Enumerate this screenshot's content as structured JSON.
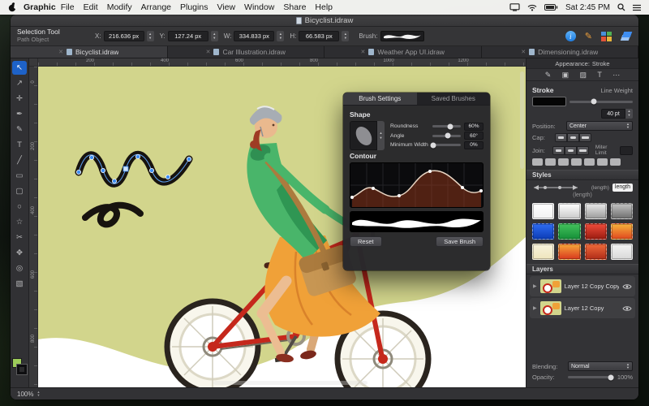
{
  "menubar": {
    "app_name": "Graphic",
    "menus": [
      "File",
      "Edit",
      "Modify",
      "Arrange",
      "Plugins",
      "View",
      "Window",
      "Share",
      "Help"
    ],
    "clock": "Sat 2:45 PM"
  },
  "window": {
    "title": "Bicyclist.idraw"
  },
  "toolbar": {
    "tool_name": "Selection Tool",
    "object_type": "Path Object",
    "fields": [
      {
        "label": "X:",
        "value": "216.636 px"
      },
      {
        "label": "Y:",
        "value": "127.24 px"
      },
      {
        "label": "W:",
        "value": "334.833 px"
      },
      {
        "label": "H:",
        "value": "66.583 px"
      }
    ],
    "brush_label": "Brush:"
  },
  "tabs": [
    {
      "label": "Bicyclist.idraw",
      "active": true
    },
    {
      "label": "Car Illustration.idraw",
      "active": false
    },
    {
      "label": "Weather App UI.idraw",
      "active": false
    },
    {
      "label": "Dimensioning.idraw",
      "active": false
    }
  ],
  "tools": [
    {
      "name": "selection-tool",
      "glyph": "↖",
      "active": true
    },
    {
      "name": "direct-selection-tool",
      "glyph": "↗",
      "active": false
    },
    {
      "name": "move-tool",
      "glyph": "✛",
      "active": false
    },
    {
      "name": "pen-tool",
      "glyph": "✒",
      "active": false
    },
    {
      "name": "pencil-tool",
      "glyph": "✎",
      "active": false
    },
    {
      "name": "text-tool",
      "glyph": "T",
      "active": false
    },
    {
      "name": "line-tool",
      "glyph": "╱",
      "active": false
    },
    {
      "name": "rectangle-tool",
      "glyph": "▭",
      "active": false
    },
    {
      "name": "rounded-rect-tool",
      "glyph": "▢",
      "active": false
    },
    {
      "name": "ellipse-tool",
      "glyph": "○",
      "active": false
    },
    {
      "name": "star-tool",
      "glyph": "☆",
      "active": false
    },
    {
      "name": "scissors-tool",
      "glyph": "✂",
      "active": false
    },
    {
      "name": "hand-tool",
      "glyph": "✥",
      "active": false
    },
    {
      "name": "zoom-tool",
      "glyph": "◎",
      "active": false
    },
    {
      "name": "gradient-tool",
      "glyph": "▧",
      "active": false
    }
  ],
  "rulers": {
    "top": [
      "200",
      "400",
      "600",
      "800",
      "1000",
      "1200"
    ],
    "left": [
      "0",
      "200",
      "400",
      "600",
      "800"
    ]
  },
  "brush_panel": {
    "tabs": [
      {
        "label": "Brush Settings",
        "active": true
      },
      {
        "label": "Saved Brushes",
        "active": false
      }
    ],
    "shape_title": "Shape",
    "sliders": [
      {
        "label": "Roundness",
        "value": "60%",
        "knob": "62%"
      },
      {
        "label": "Angle",
        "value": "60°",
        "knob": "55%"
      },
      {
        "label": "Minimum Width",
        "value": "0%",
        "knob": "4%"
      }
    ],
    "contour_title": "Contour",
    "reset_label": "Reset",
    "save_label": "Save Brush"
  },
  "sidebar": {
    "appearance_label": "Appearance:",
    "appearance_value": "Stroke",
    "appearance_icons": [
      "✎",
      "▣",
      "▨",
      "T",
      "⋯"
    ],
    "stroke": {
      "title": "Stroke",
      "line_weight_label": "Line Weight",
      "weight_knob": "38%",
      "line_weight_value": "40 pt",
      "position_label": "Position:",
      "position_value": "Center",
      "cap_label": "Cap:",
      "join_label": "Join:",
      "miter_limit_label": "Miter Limit"
    },
    "styles": {
      "title": "Styles",
      "length_inline": "(length)",
      "length_chip": "length",
      "length_caption": "(length)",
      "swatches": [
        {
          "bg": "linear-gradient(180deg,#ffffff,#f2f2f2)"
        },
        {
          "bg": "linear-gradient(180deg,#ffffff,#c9c9c9)"
        },
        {
          "bg": "linear-gradient(180deg,#e9e9e9,#9b9b9b)"
        },
        {
          "bg": "linear-gradient(180deg,#c4c4c4,#6e6e6e)"
        },
        {
          "bg": "linear-gradient(180deg,#2f6bf0,#0c3db8)"
        },
        {
          "bg": "linear-gradient(180deg,#43c05c,#159038)"
        },
        {
          "bg": "linear-gradient(180deg,#ef4b3a,#9c1c10)"
        },
        {
          "bg": "linear-gradient(180deg,#f7b23c,#e0491f)"
        },
        {
          "bg": "linear-gradient(180deg,#f8f3dc,#efe5bd)"
        },
        {
          "bg": "linear-gradient(180deg,#f7a63a,#d8391e)"
        },
        {
          "bg": "linear-gradient(180deg,#ef6a3a,#b02c18)"
        },
        {
          "bg": "linear-gradient(180deg,#f4f4f4,#d9d9d9)"
        }
      ]
    },
    "layers": {
      "title": "Layers",
      "items": [
        {
          "name": "Layer 12 Copy Copy"
        },
        {
          "name": "Layer 12 Copy"
        }
      ],
      "blending_label": "Blending:",
      "blending_value": "Normal",
      "opacity_label": "Opacity:",
      "opacity_value": "100%",
      "opacity_knob": "94%"
    }
  },
  "status": {
    "zoom": "100%"
  },
  "icons": {
    "close": "✕",
    "disclosure": "▶",
    "up": "▲",
    "down": "▼",
    "info": "i"
  },
  "colors": {
    "canvas": "#d2d58c",
    "selection_blue": "#3f8ef2",
    "bike_red": "#c5281c",
    "jacket_green": "#49b56a",
    "skirt_orange": "#f0a138"
  }
}
